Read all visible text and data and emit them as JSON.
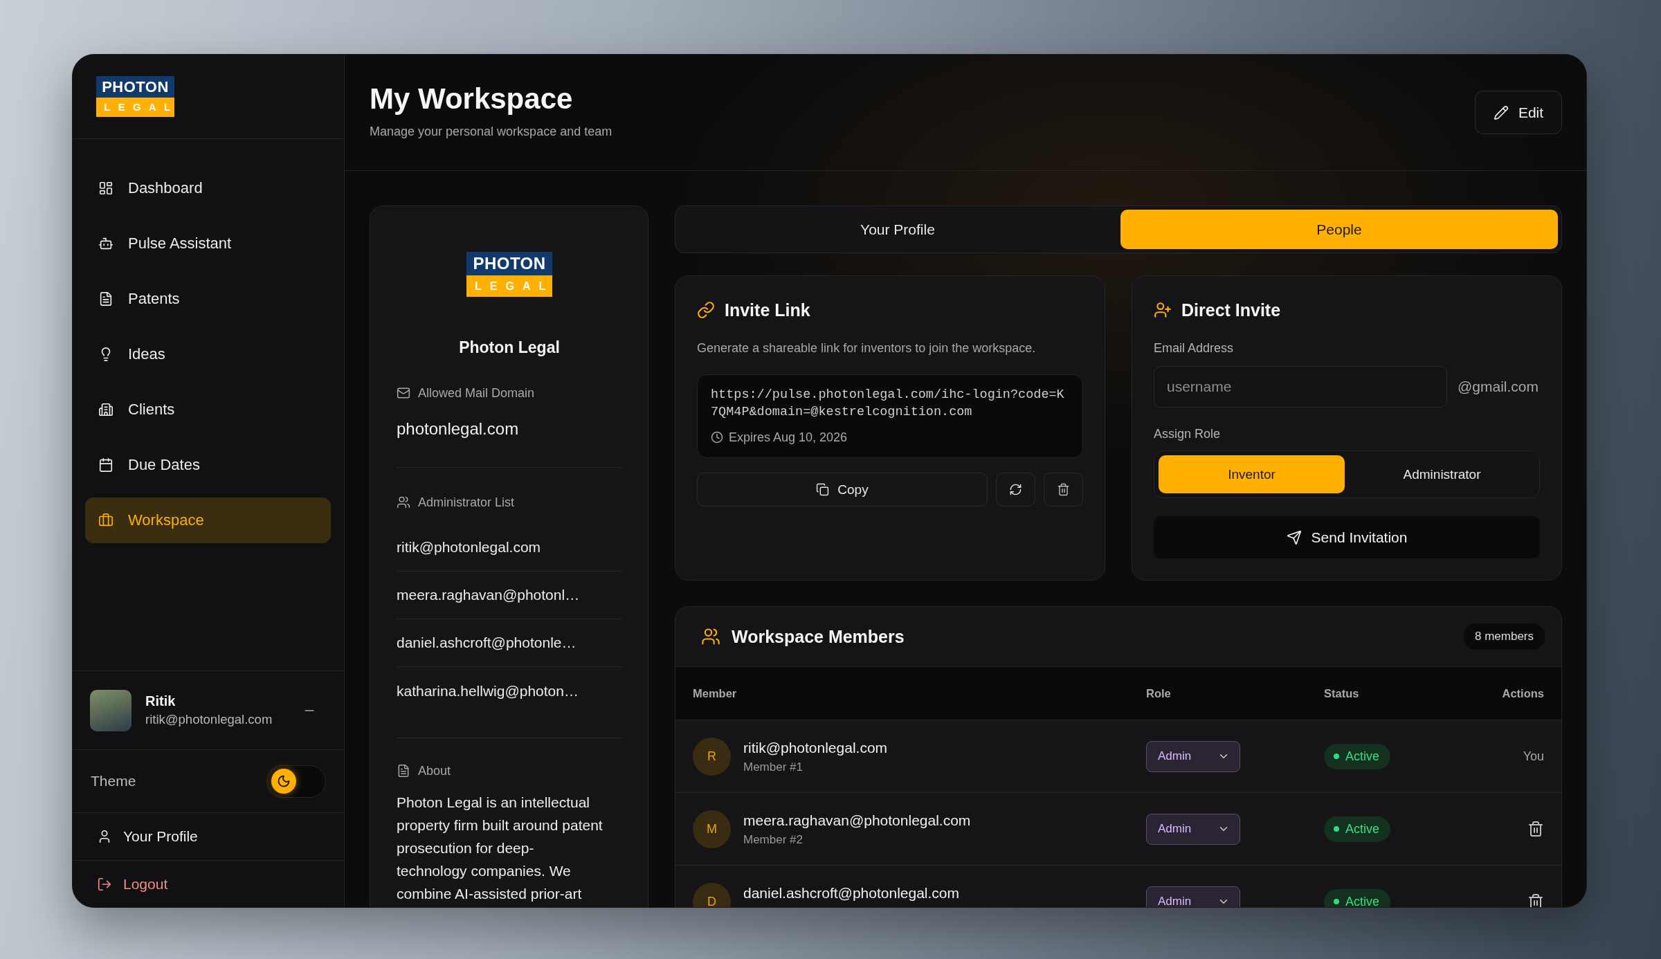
{
  "sidebar": {
    "logo": {
      "top": "PHOTON",
      "bottom": "LEGAL"
    },
    "nav": [
      {
        "label": "Dashboard",
        "selected": false
      },
      {
        "label": "Pulse Assistant",
        "selected": false
      },
      {
        "label": "Patents",
        "selected": false
      },
      {
        "label": "Ideas",
        "selected": false
      },
      {
        "label": "Clients",
        "selected": false
      },
      {
        "label": "Due Dates",
        "selected": false
      },
      {
        "label": "Workspace",
        "selected": true
      }
    ],
    "user": {
      "name": "Ritik",
      "email": "ritik@photonlegal.com"
    },
    "theme": {
      "label": "Theme",
      "dark": true
    },
    "profile_link": "Your Profile",
    "logout_link": "Logout"
  },
  "header": {
    "title": "My Workspace",
    "subtitle": "Manage your personal workspace and team",
    "edit_button": "Edit"
  },
  "profile_card": {
    "logo": {
      "top": "PHOTON",
      "bottom": "LEGAL"
    },
    "name": "Photon Legal",
    "mail_domain": {
      "label": "Allowed Mail Domain",
      "value": "photonlegal.com"
    },
    "administrators": {
      "label": "Administrator List",
      "items": [
        "ritik@photonlegal.com",
        "meera.raghavan@photonl…",
        "daniel.ashcroft@photonle…",
        "katharina.hellwig@photon…"
      ]
    },
    "about": {
      "label": "About",
      "text": "Photon Legal is an intellectual property firm built around patent prosecution for deep-technology companies. We combine AI-assisted prior-art"
    }
  },
  "tabs": [
    {
      "label": "Your Profile",
      "selected": false
    },
    {
      "label": "People",
      "selected": true
    }
  ],
  "invite_link": {
    "title": "Invite Link",
    "description": "Generate a shareable link for inventors to join the workspace.",
    "url": "https://pulse.photonlegal.com/ihc-login?code=K7QM4P&domain=@kestrelcognition.com",
    "expires": "Expires Aug 10, 2026",
    "copy_button": "Copy"
  },
  "direct_invite": {
    "title": "Direct Invite",
    "email_label": "Email Address",
    "placeholder": "username",
    "domain": "@gmail.com",
    "role_label": "Assign Role",
    "roles": [
      {
        "label": "Inventor",
        "selected": true
      },
      {
        "label": "Administrator",
        "selected": false
      }
    ],
    "send_button": "Send Invitation"
  },
  "members": {
    "title": "Workspace Members",
    "count": "8 members",
    "columns": [
      "Member",
      "Role",
      "Status",
      "Actions"
    ],
    "rows": [
      {
        "initial": "R",
        "email": "ritik@photonlegal.com",
        "subtitle": "Member #1",
        "role": "Admin",
        "status": "Active",
        "action": {
          "kind": "text",
          "text": "You"
        }
      },
      {
        "initial": "M",
        "email": "meera.raghavan@photonlegal.com",
        "subtitle": "Member #2",
        "role": "Admin",
        "status": "Active",
        "action": {
          "kind": "delete"
        }
      },
      {
        "initial": "D",
        "email": "daniel.ashcroft@photonlegal.com",
        "role": "Admin",
        "status": "Active",
        "action": {
          "kind": "delete"
        }
      }
    ]
  }
}
